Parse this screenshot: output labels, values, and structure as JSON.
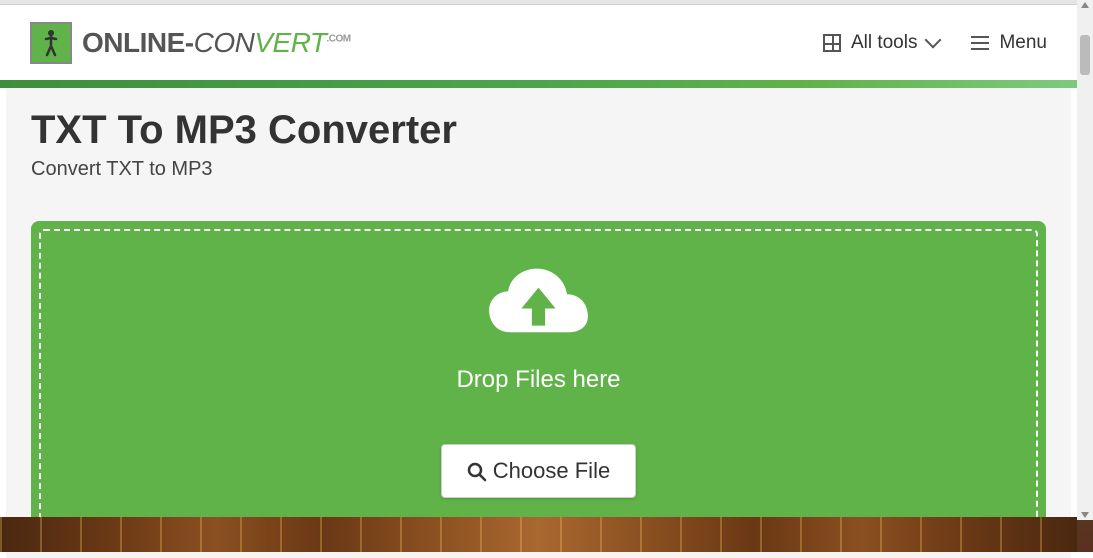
{
  "brand": {
    "text_part1": "ONLINE-",
    "text_part2": "CON",
    "text_part3": "VERT",
    "text_suffix": ".COM"
  },
  "nav": {
    "all_tools": "All tools",
    "menu": "Menu"
  },
  "page": {
    "title": "TXT To MP3 Converter",
    "subtitle": "Convert TXT to MP3"
  },
  "dropzone": {
    "drop_text": "Drop Files here",
    "choose_button": "Choose File"
  }
}
